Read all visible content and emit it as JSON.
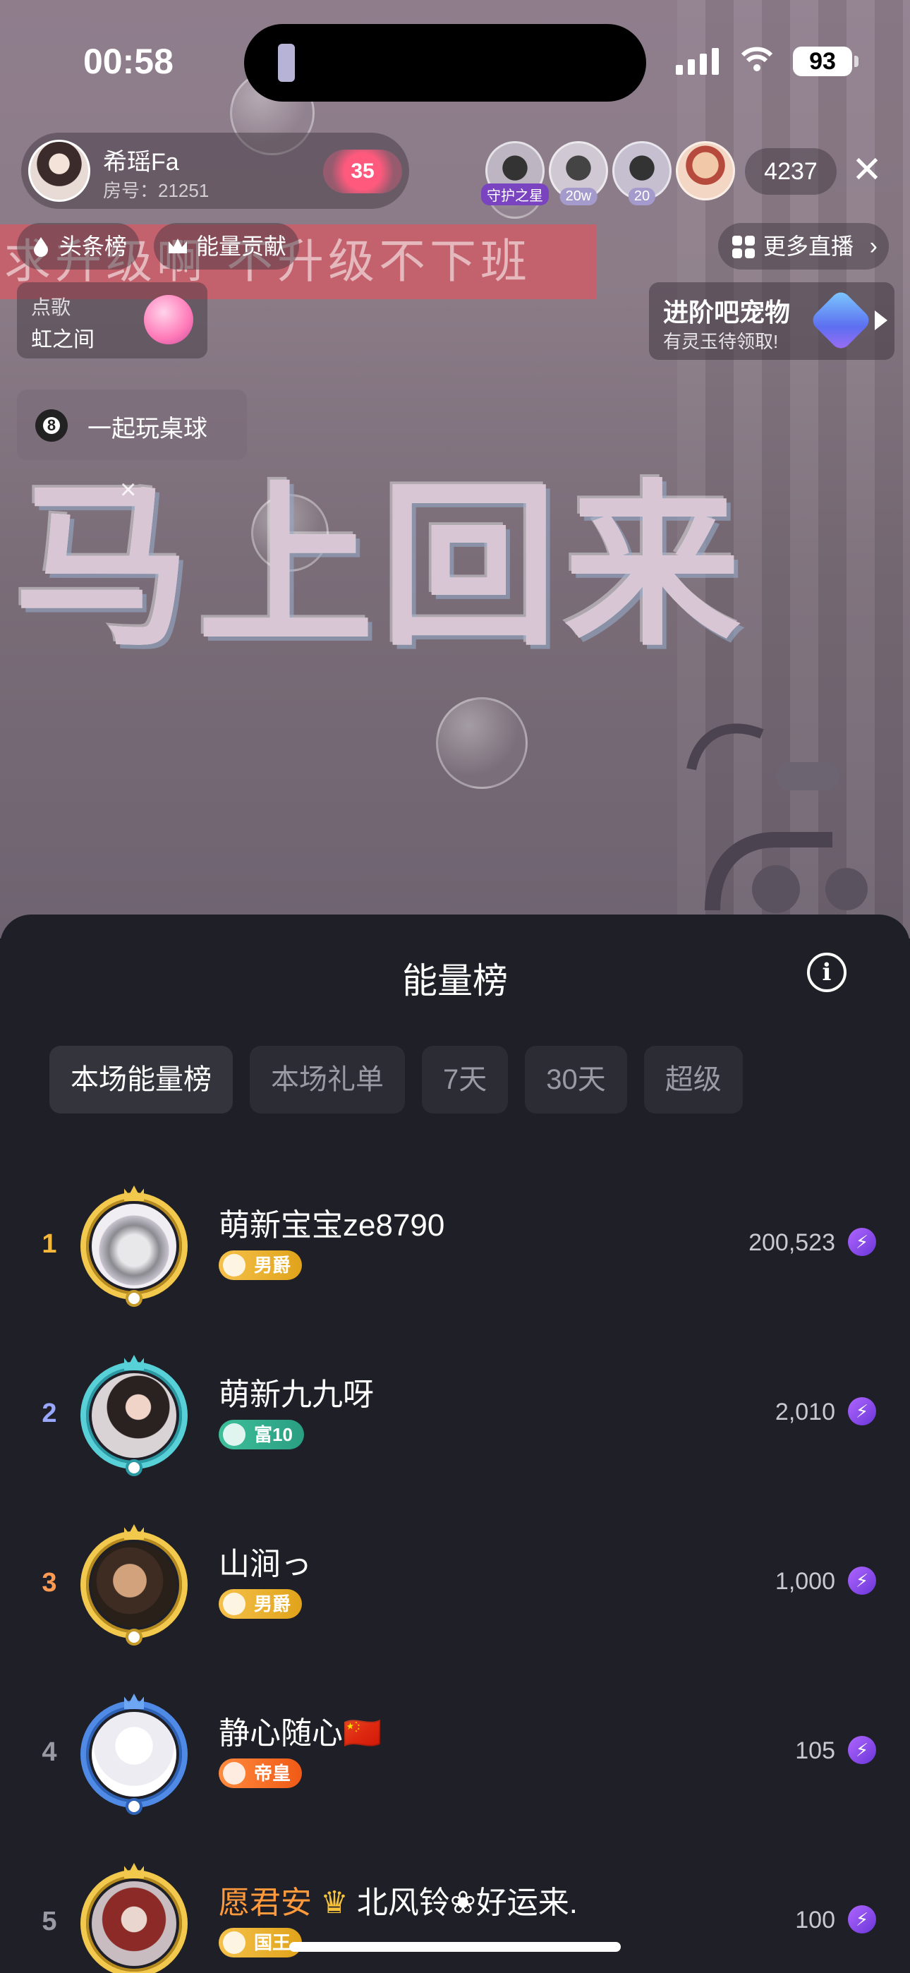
{
  "status_bar": {
    "time": "00:58",
    "battery": "93"
  },
  "host": {
    "name": "希瑶Fa",
    "room": "房号：21251",
    "hearts": "35"
  },
  "viewers": [
    {
      "tag": "守护之星"
    },
    {
      "tag": "20w"
    },
    {
      "tag": "20"
    },
    {
      "tag": ""
    }
  ],
  "viewer_count": "4237",
  "chips": {
    "headline": "头条榜",
    "energy": "能量贡献",
    "more_live": "更多直播"
  },
  "video_text": {
    "banner": "求升级啊 不升级不下班",
    "big_title": "马上回来"
  },
  "song": {
    "line1": "点歌",
    "line2": "虹之间"
  },
  "pet": {
    "title": "进阶吧宠物",
    "subtitle": "有灵玉待领取!"
  },
  "billiard": {
    "label": "一起玩桌球"
  },
  "sheet": {
    "title": "能量榜",
    "tabs": [
      "本场能量榜",
      "本场礼单",
      "7天",
      "30天",
      "超级"
    ],
    "rows": [
      {
        "rank": "1",
        "name": "萌新宝宝ze8790",
        "badge": "男爵",
        "score": "200,523"
      },
      {
        "rank": "2",
        "name": "萌新九九呀",
        "badge": "富10",
        "score": "2,010"
      },
      {
        "rank": "3",
        "name": "山涧っ",
        "badge": "男爵",
        "score": "1,000"
      },
      {
        "rank": "4",
        "name": "静心随心🇨🇳",
        "badge": "帝皇",
        "score": "105"
      },
      {
        "rank": "5",
        "name": "愿君安",
        "name_extra": "北风铃❀好运来.",
        "badge": "国王",
        "score": "100"
      }
    ]
  },
  "colors": {
    "rank1": "#f5b83c",
    "rank2": "#9aa7ff",
    "rank3": "#ff9a52",
    "rank_other": "#9a9aa4"
  }
}
